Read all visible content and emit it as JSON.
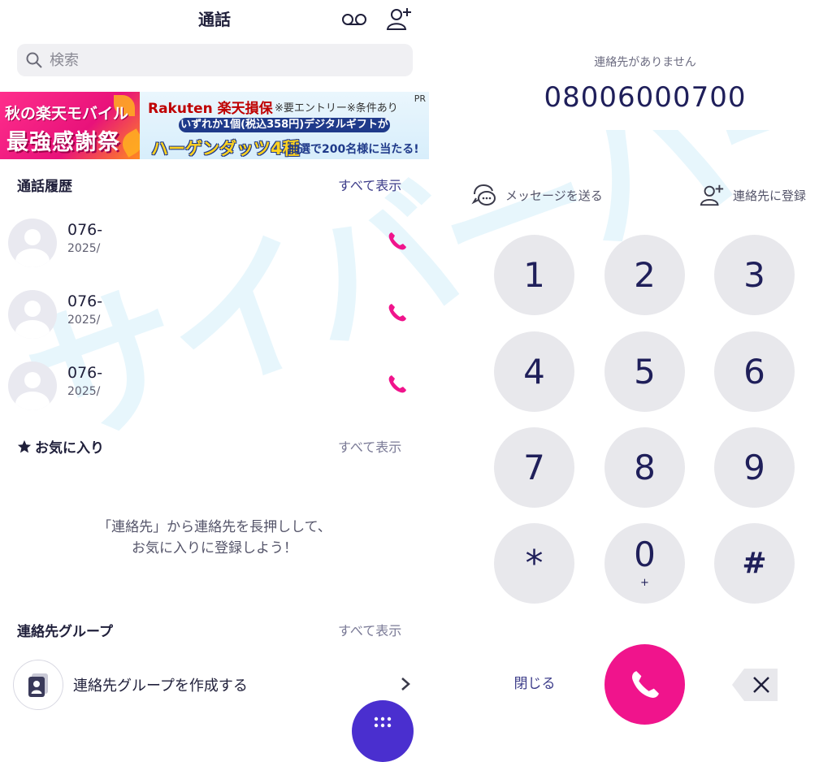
{
  "left": {
    "header": {
      "title": "通話"
    },
    "search": {
      "placeholder": "検索"
    },
    "banner": {
      "left_line1": "秋の楽天モバイル",
      "left_line2": "最強感謝祭",
      "brand": "Rakuten 楽天損保",
      "note": "※要エントリー※条件あり",
      "pr": "PR",
      "pill": "いずれか1個(税込358円)デジタルギフトが",
      "big": "ハーゲンダッツ4種",
      "small": "抽選で200名様に当たる!"
    },
    "history": {
      "title": "通話履歴",
      "show_all": "すべて表示",
      "rows": [
        {
          "number": "076-",
          "date": "2025/"
        },
        {
          "number": "076-",
          "date": "2025/"
        },
        {
          "number": "076-",
          "date": "2025/"
        }
      ]
    },
    "favorites": {
      "title": "お気に入り",
      "show_all": "すべて表示",
      "empty_line1": "「連絡先」から連絡先を長押しして、",
      "empty_line2": "お気に入りに登録しよう！"
    },
    "groups": {
      "title": "連絡先グループ",
      "show_all": "すべて表示",
      "create_label": "連絡先グループを作成する"
    }
  },
  "right": {
    "status": "連絡先がありません",
    "number": "08006000700",
    "send_message": "メッセージを送る",
    "register_contact": "連絡先に登録",
    "keys": [
      {
        "digit": "1",
        "sub": ""
      },
      {
        "digit": "2",
        "sub": ""
      },
      {
        "digit": "3",
        "sub": ""
      },
      {
        "digit": "4",
        "sub": ""
      },
      {
        "digit": "5",
        "sub": ""
      },
      {
        "digit": "6",
        "sub": ""
      },
      {
        "digit": "7",
        "sub": ""
      },
      {
        "digit": "8",
        "sub": ""
      },
      {
        "digit": "9",
        "sub": ""
      },
      {
        "digit": "*",
        "sub": ""
      },
      {
        "digit": "0",
        "sub": "+"
      },
      {
        "digit": "#",
        "sub": ""
      }
    ],
    "close_label": "閉じる"
  },
  "watermark": "サイバーバード",
  "colors": {
    "accent": "#f0148c",
    "fab": "#4a2fcf",
    "navy_text": "#1f1f5a",
    "key_bg": "#e8e8ec"
  }
}
